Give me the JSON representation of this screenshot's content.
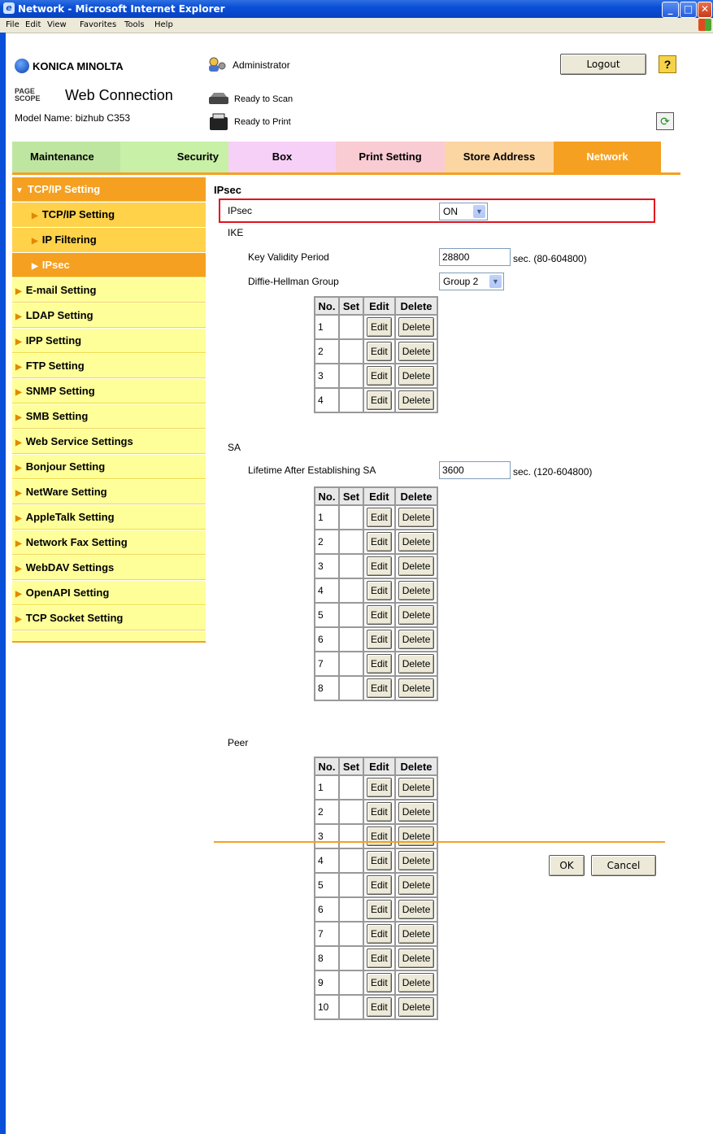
{
  "window": {
    "title": "Network - Microsoft Internet Explorer"
  },
  "menu": [
    "File",
    "Edit",
    "View",
    "Favorites",
    "Tools",
    "Help"
  ],
  "header": {
    "brand": "KONICA MINOLTA",
    "product": "Web Connection",
    "product_mark": "PAGE SCOPE",
    "model": "Model Name: bizhub C353",
    "user": "Administrator",
    "scan_status": "Ready to Scan",
    "print_status": "Ready to Print",
    "logout": "Logout",
    "help": "?"
  },
  "tabs": [
    {
      "label": "Maintenance",
      "color": "#bfe6a0"
    },
    {
      "label": "Security",
      "color": "#c8f0a6"
    },
    {
      "label": "Box",
      "color": "#f7d0f7"
    },
    {
      "label": "Print Setting",
      "color": "#f9cbd3"
    },
    {
      "label": "Store Address",
      "color": "#fbd6a3"
    },
    {
      "label": "Network",
      "color": "#f5a021",
      "active": true
    }
  ],
  "sidebar": [
    {
      "label": "TCP/IP Setting",
      "level": 0,
      "expanded": true
    },
    {
      "label": "TCP/IP Setting",
      "level": 1
    },
    {
      "label": "IP Filtering",
      "level": 1
    },
    {
      "label": "IPsec",
      "level": 1,
      "active": true
    },
    {
      "label": "E-mail Setting",
      "level": 0
    },
    {
      "label": "LDAP Setting",
      "level": 0
    },
    {
      "label": "IPP Setting",
      "level": 0
    },
    {
      "label": "FTP Setting",
      "level": 0
    },
    {
      "label": "SNMP Setting",
      "level": 0
    },
    {
      "label": "SMB Setting",
      "level": 0
    },
    {
      "label": "Web Service Settings",
      "level": 0
    },
    {
      "label": "Bonjour Setting",
      "level": 0
    },
    {
      "label": "NetWare Setting",
      "level": 0
    },
    {
      "label": "AppleTalk Setting",
      "level": 0
    },
    {
      "label": "Network Fax Setting",
      "level": 0
    },
    {
      "label": "WebDAV Settings",
      "level": 0
    },
    {
      "label": "OpenAPI Setting",
      "level": 0
    },
    {
      "label": "TCP Socket Setting",
      "level": 0
    }
  ],
  "content": {
    "heading": "IPsec",
    "ipsec_label": "IPsec",
    "ipsec_value": "ON",
    "ike_label": "IKE",
    "key_validity_label": "Key Validity Period",
    "key_validity_value": "28800",
    "key_validity_unit": "sec. (80-604800)",
    "dh_group_label": "Diffie-Hellman Group",
    "dh_group_value": "Group 2",
    "sa_label": "SA",
    "lifetime_label": "Lifetime After Establishing SA",
    "lifetime_value": "3600",
    "lifetime_unit": "sec. (120-604800)",
    "peer_label": "Peer",
    "table_headers": [
      "No.",
      "Set",
      "Edit",
      "Delete"
    ],
    "edit_label": "Edit",
    "delete_label": "Delete",
    "ike_rows": [
      "1",
      "2",
      "3",
      "4"
    ],
    "sa_rows": [
      "1",
      "2",
      "3",
      "4",
      "5",
      "6",
      "7",
      "8"
    ],
    "peer_rows": [
      "1",
      "2",
      "3",
      "4",
      "5",
      "6",
      "7",
      "8",
      "9",
      "10"
    ],
    "ok": "OK",
    "cancel": "Cancel"
  },
  "colors": {
    "accent": "#f5a021",
    "sidebar_bg": "#ffff99",
    "sidebar_sub_bg": "#ffd24a",
    "highlight": "#e3121d"
  }
}
